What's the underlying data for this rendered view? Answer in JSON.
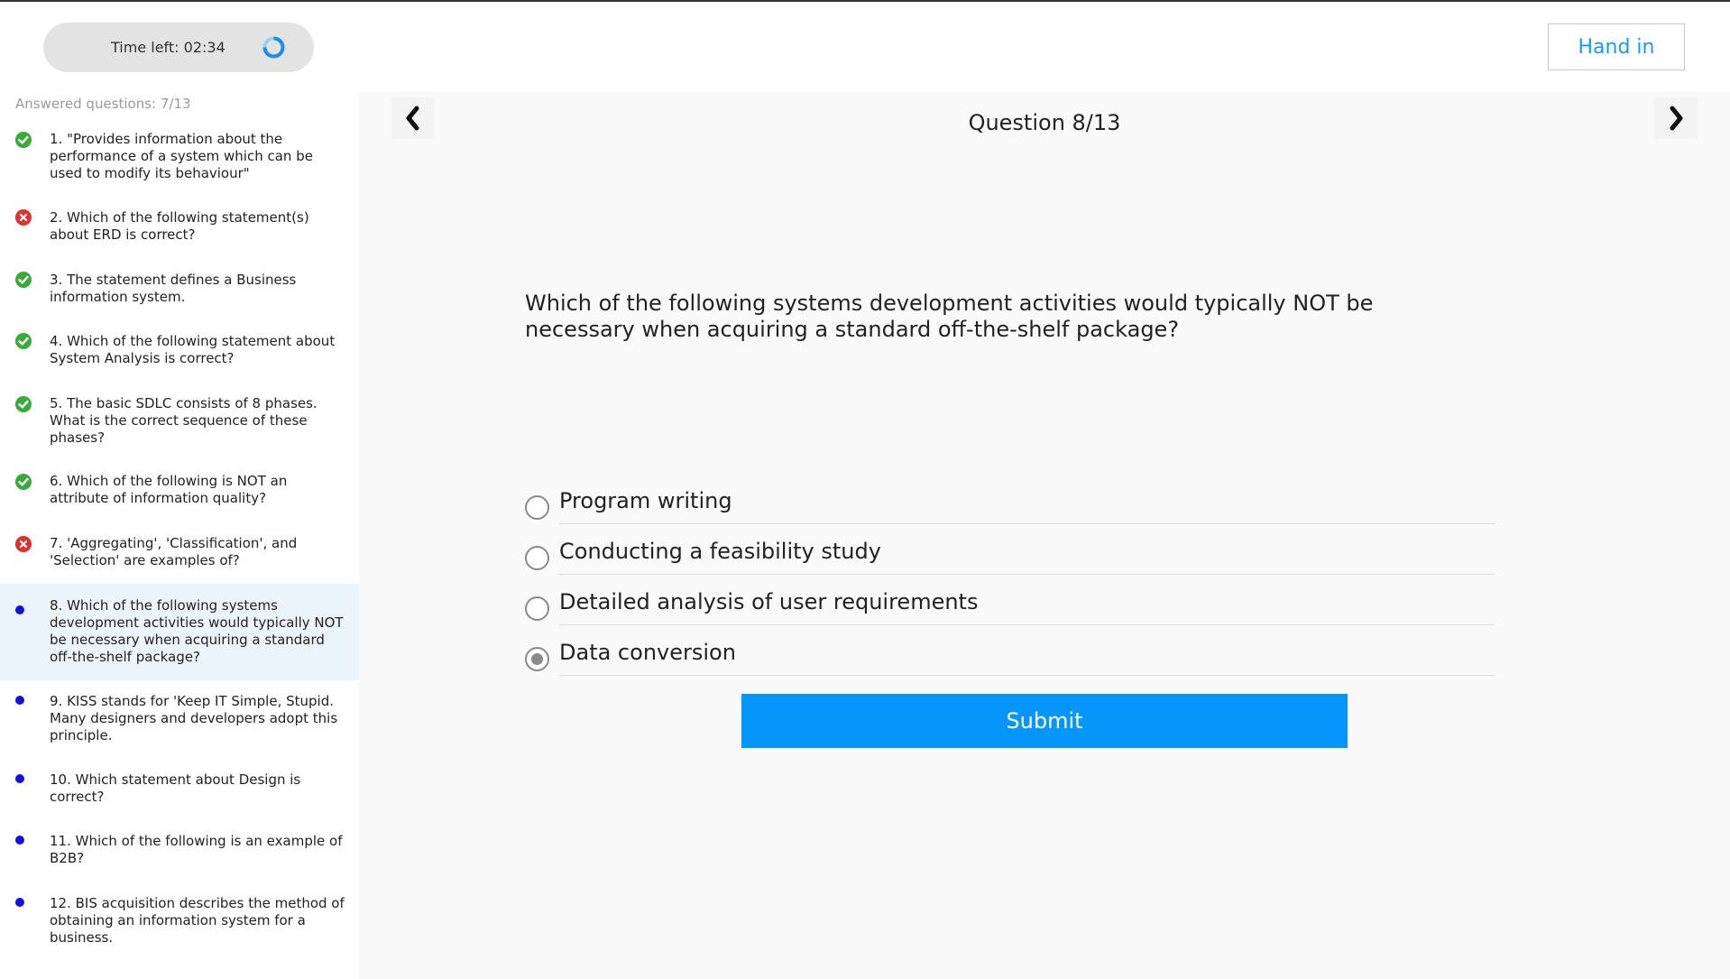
{
  "timer": {
    "label": "Time left: 02:34"
  },
  "header": {
    "hand_in_label": "Hand in"
  },
  "sidebar": {
    "answered_label": "Answered questions: 7/13",
    "items": [
      {
        "text": "1. \"Provides information about the performance of a system which can be used to modify its behaviour\"",
        "status": "correct"
      },
      {
        "text": "2. Which of the following statement(s) about ERD is correct?",
        "status": "wrong"
      },
      {
        "text": "3. The statement defines a Business information system.",
        "status": "correct"
      },
      {
        "text": "4. Which of the following statement about System Analysis is correct?",
        "status": "correct"
      },
      {
        "text": "5. The basic SDLC consists of 8 phases. What is the correct sequence of these phases?",
        "status": "correct"
      },
      {
        "text": "6. Which of the following is NOT an attribute of information quality?",
        "status": "correct"
      },
      {
        "text": "7. 'Aggregating', 'Classification', and 'Selection' are examples of?",
        "status": "wrong"
      },
      {
        "text": "8. Which of the following systems development activities would typically NOT be necessary when acquiring a standard off-the-shelf package?",
        "status": "current"
      },
      {
        "text": "9. KISS stands for 'Keep IT Simple, Stupid. Many designers and developers adopt this principle.",
        "status": "pending"
      },
      {
        "text": "10. Which statement about Design is correct?",
        "status": "pending"
      },
      {
        "text": "11. Which of the following is an example of B2B?",
        "status": "pending"
      },
      {
        "text": "12. BIS acquisition describes the method of obtaining an information system for a business.",
        "status": "pending"
      }
    ]
  },
  "main": {
    "question_counter": "Question 8/13",
    "question_text": "Which of the following systems development activities would typically NOT be necessary when acquiring a standard off-the-shelf package?",
    "options": [
      {
        "label": "Program writing",
        "selected": false
      },
      {
        "label": "Conducting a feasibility study",
        "selected": false
      },
      {
        "label": "Detailed analysis of user requirements",
        "selected": false
      },
      {
        "label": "Data conversion",
        "selected": true
      }
    ],
    "submit_label": "Submit"
  },
  "icons": {
    "prev": "chevron-left-icon",
    "next": "chevron-right-icon",
    "timer": "spinner-ring-icon",
    "correct": "check-circle-icon",
    "wrong": "x-circle-icon",
    "pending": "dot-icon"
  },
  "colors": {
    "accent": "#0496fb",
    "hand_in_text": "#1a9be8",
    "correct": "#3aaa3a",
    "wrong": "#e03030",
    "pending": "#1010e0",
    "current_bg": "#ebf4fb"
  }
}
